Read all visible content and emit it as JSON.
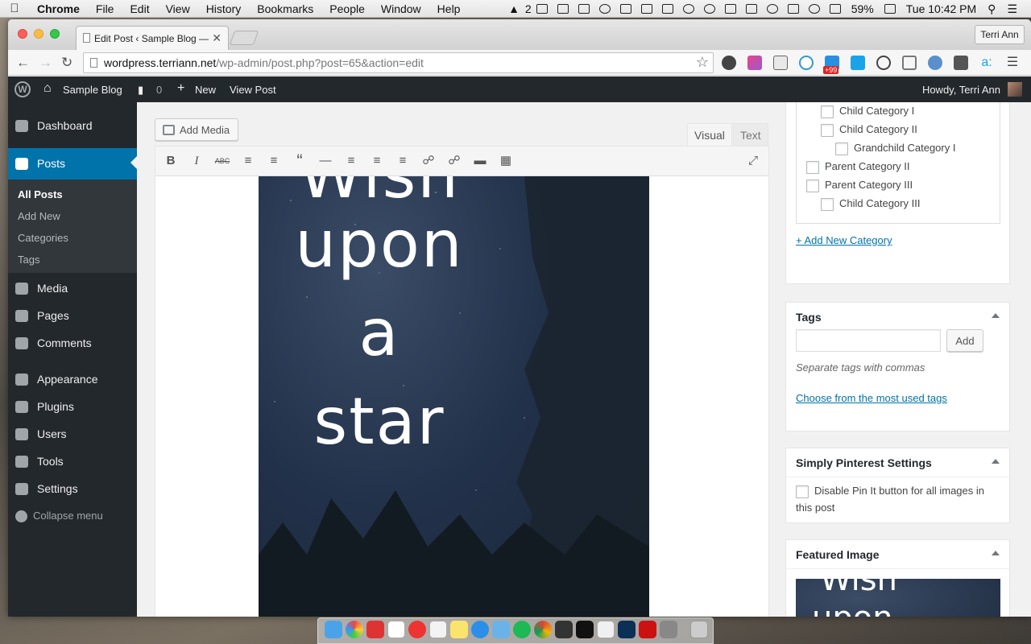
{
  "menubar": {
    "app": "Chrome",
    "menus": [
      "File",
      "Edit",
      "View",
      "History",
      "Bookmarks",
      "People",
      "Window",
      "Help"
    ],
    "adobe_count": "2",
    "battery": "59%",
    "clock": "Tue 10:42 PM"
  },
  "browser": {
    "tab_title": "Edit Post ‹ Sample Blog —",
    "profile": "Terri Ann",
    "url_host": "wordpress.terriann.net",
    "url_path": "/wp-admin/post.php?post=65&action=edit",
    "ext_badge": "+99"
  },
  "adminbar": {
    "site": "Sample Blog",
    "comments": "0",
    "new": "New",
    "view_post": "View Post",
    "howdy": "Howdy, Terri Ann"
  },
  "sidebar": {
    "dashboard": "Dashboard",
    "posts": "Posts",
    "sub": [
      "All Posts",
      "Add New",
      "Categories",
      "Tags"
    ],
    "media": "Media",
    "pages": "Pages",
    "comments": "Comments",
    "appearance": "Appearance",
    "plugins": "Plugins",
    "users": "Users",
    "tools": "Tools",
    "settings": "Settings",
    "collapse": "Collapse menu"
  },
  "editor": {
    "add_media": "Add Media",
    "tab_visual": "Visual",
    "tab_text": "Text",
    "image_lines": [
      "Wish",
      "upon",
      "a",
      "star"
    ]
  },
  "categories": {
    "items": [
      "Child Category I",
      "Child Category II",
      "Grandchild Category I",
      "Parent Category II",
      "Parent Category III",
      "Child Category III"
    ],
    "add_new": "+ Add New Category"
  },
  "tags": {
    "title": "Tags",
    "add_button": "Add",
    "help": "Separate tags with commas",
    "choose": "Choose from the most used tags"
  },
  "pinterest": {
    "title": "Simply Pinterest Settings",
    "option_line1": "Disable Pin It button for all images in",
    "option_line2": "this post"
  },
  "featured": {
    "title": "Featured Image",
    "image_lines": [
      "Wish",
      "upon"
    ]
  },
  "colors": {
    "admin_dark": "#23282d",
    "admin_blue": "#0073aa"
  }
}
